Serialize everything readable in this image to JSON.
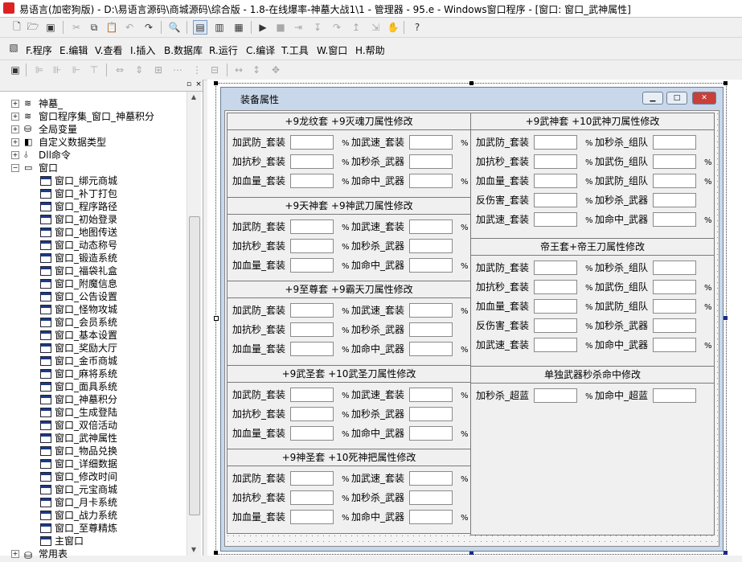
{
  "window_title": "易语言(加密狗版) - D:\\易语言源码\\商城源码\\综合版 - 1.8-在线爆率-神墓大战1\\1 - 管理器 - 95.e - Windows窗口程序 - [窗口: 窗口_武神属性]",
  "menu": [
    "F.程序",
    "E.编辑",
    "V.查看",
    "I.插入",
    "B.数据库",
    "R.运行",
    "C.编译",
    "T.工具",
    "W.窗口",
    "H.帮助"
  ],
  "tree": {
    "top_nodes": [
      "神墓_",
      "窗口程序集_窗口_神墓积分",
      "全局变量",
      "自定义数据类型",
      "Dll命令",
      "窗口"
    ],
    "windows": [
      "窗口_绑元商城",
      "窗口_补丁打包",
      "窗口_程序路径",
      "窗口_初始登录",
      "窗口_地图传送",
      "窗口_动态称号",
      "窗口_锻造系统",
      "窗口_福袋礼盒",
      "窗口_附魔信息",
      "窗口_公告设置",
      "窗口_怪物攻城",
      "窗口_会员系统",
      "窗口_基本设置",
      "窗口_奖励大厅",
      "窗口_金币商城",
      "窗口_麻将系统",
      "窗口_面具系统",
      "窗口_神墓积分",
      "窗口_生成登陆",
      "窗口_双倍活动",
      "窗口_武神属性",
      "窗口_物品兑换",
      "窗口_详细数据",
      "窗口_修改时间",
      "窗口_元宝商城",
      "窗口_月卡系统",
      "窗口_战力系统",
      "窗口_至尊精炼",
      "主窗口"
    ],
    "bottom_node": "常用表"
  },
  "form": {
    "title": "装备属性",
    "pct": "%",
    "left_groups": [
      {
        "title": "+9龙纹套 +9灭魂刀属性修改",
        "rows": [
          [
            "加武防_套装",
            "加武速_套装"
          ],
          [
            "加抗秒_套装",
            "加秒杀_武器"
          ],
          [
            "加血量_套装",
            "加命中_武器"
          ]
        ]
      },
      {
        "title": "+9天神套 +9神武刀属性修改",
        "rows": [
          [
            "加武防_套装",
            "加武速_套装"
          ],
          [
            "加抗秒_套装",
            "加秒杀_武器"
          ],
          [
            "加血量_套装",
            "加命中_武器"
          ]
        ]
      },
      {
        "title": "+9至尊套 +9霸天刀属性修改",
        "rows": [
          [
            "加武防_套装",
            "加武速_套装"
          ],
          [
            "加抗秒_套装",
            "加秒杀_武器"
          ],
          [
            "加血量_套装",
            "加命中_武器"
          ]
        ]
      },
      {
        "title": "+9武圣套 +10武圣刀属性修改",
        "rows": [
          [
            "加武防_套装",
            "加武速_套装"
          ],
          [
            "加抗秒_套装",
            "加秒杀_武器"
          ],
          [
            "加血量_套装",
            "加命中_武器"
          ]
        ]
      },
      {
        "title": "+9神圣套 +10死神把属性修改",
        "rows": [
          [
            "加武防_套装",
            "加武速_套装"
          ],
          [
            "加抗秒_套装",
            "加秒杀_武器"
          ],
          [
            "加血量_套装",
            "加命中_武器"
          ]
        ]
      }
    ],
    "right_groups": [
      {
        "title": "+9武神套 +10武神刀属性修改",
        "rows": [
          [
            "加武防_套装",
            "加秒杀_组队"
          ],
          [
            "加抗秒_套装",
            "加武伤_组队"
          ],
          [
            "加血量_套装",
            "加武防_组队"
          ],
          [
            "反伤害_套装",
            "加秒杀_武器"
          ],
          [
            "加武速_套装",
            "加命中_武器"
          ]
        ]
      },
      {
        "title": "帝王套+帝王刀属性修改",
        "rows": [
          [
            "加武防_套装",
            "加秒杀_组队"
          ],
          [
            "加抗秒_套装",
            "加武伤_组队"
          ],
          [
            "加血量_套装",
            "加武防_组队"
          ],
          [
            "反伤害_套装",
            "加秒杀_武器"
          ],
          [
            "加武速_套装",
            "加命中_武器"
          ]
        ]
      },
      {
        "title": "单独武器秒杀命中修改",
        "rows": [
          [
            "加秒杀_超蓝",
            "加命中_超蓝"
          ]
        ]
      }
    ]
  }
}
